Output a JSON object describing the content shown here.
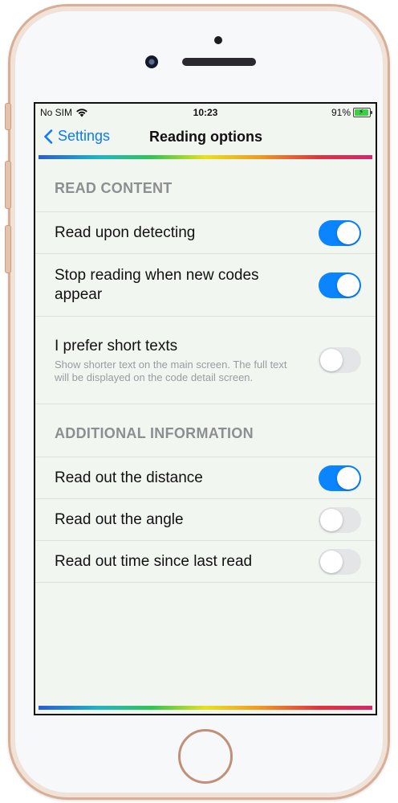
{
  "status_bar": {
    "carrier": "No SIM",
    "time": "10:23",
    "battery": "91%"
  },
  "nav": {
    "back_label": "Settings",
    "title": "Reading options"
  },
  "sections": [
    {
      "header": "READ CONTENT",
      "rows": [
        {
          "label": "Read upon detecting",
          "toggle": true
        },
        {
          "label": "Stop reading when new codes appear",
          "toggle": true
        },
        {
          "label": "I prefer short texts",
          "description": "Show shorter text on the main screen. The full text will be displayed on the code detail screen.",
          "toggle": false
        }
      ]
    },
    {
      "header": "ADDITIONAL INFORMATION",
      "rows": [
        {
          "label": "Read out the distance",
          "toggle": true
        },
        {
          "label": "Read out the angle",
          "toggle": false
        },
        {
          "label": "Read out time since last read",
          "toggle": false
        }
      ]
    }
  ],
  "colors": {
    "accent": "#0a84ff",
    "toggle_off": "#e4e5e7",
    "background": "#f2f6f1",
    "header_text": "#8c8e91"
  }
}
